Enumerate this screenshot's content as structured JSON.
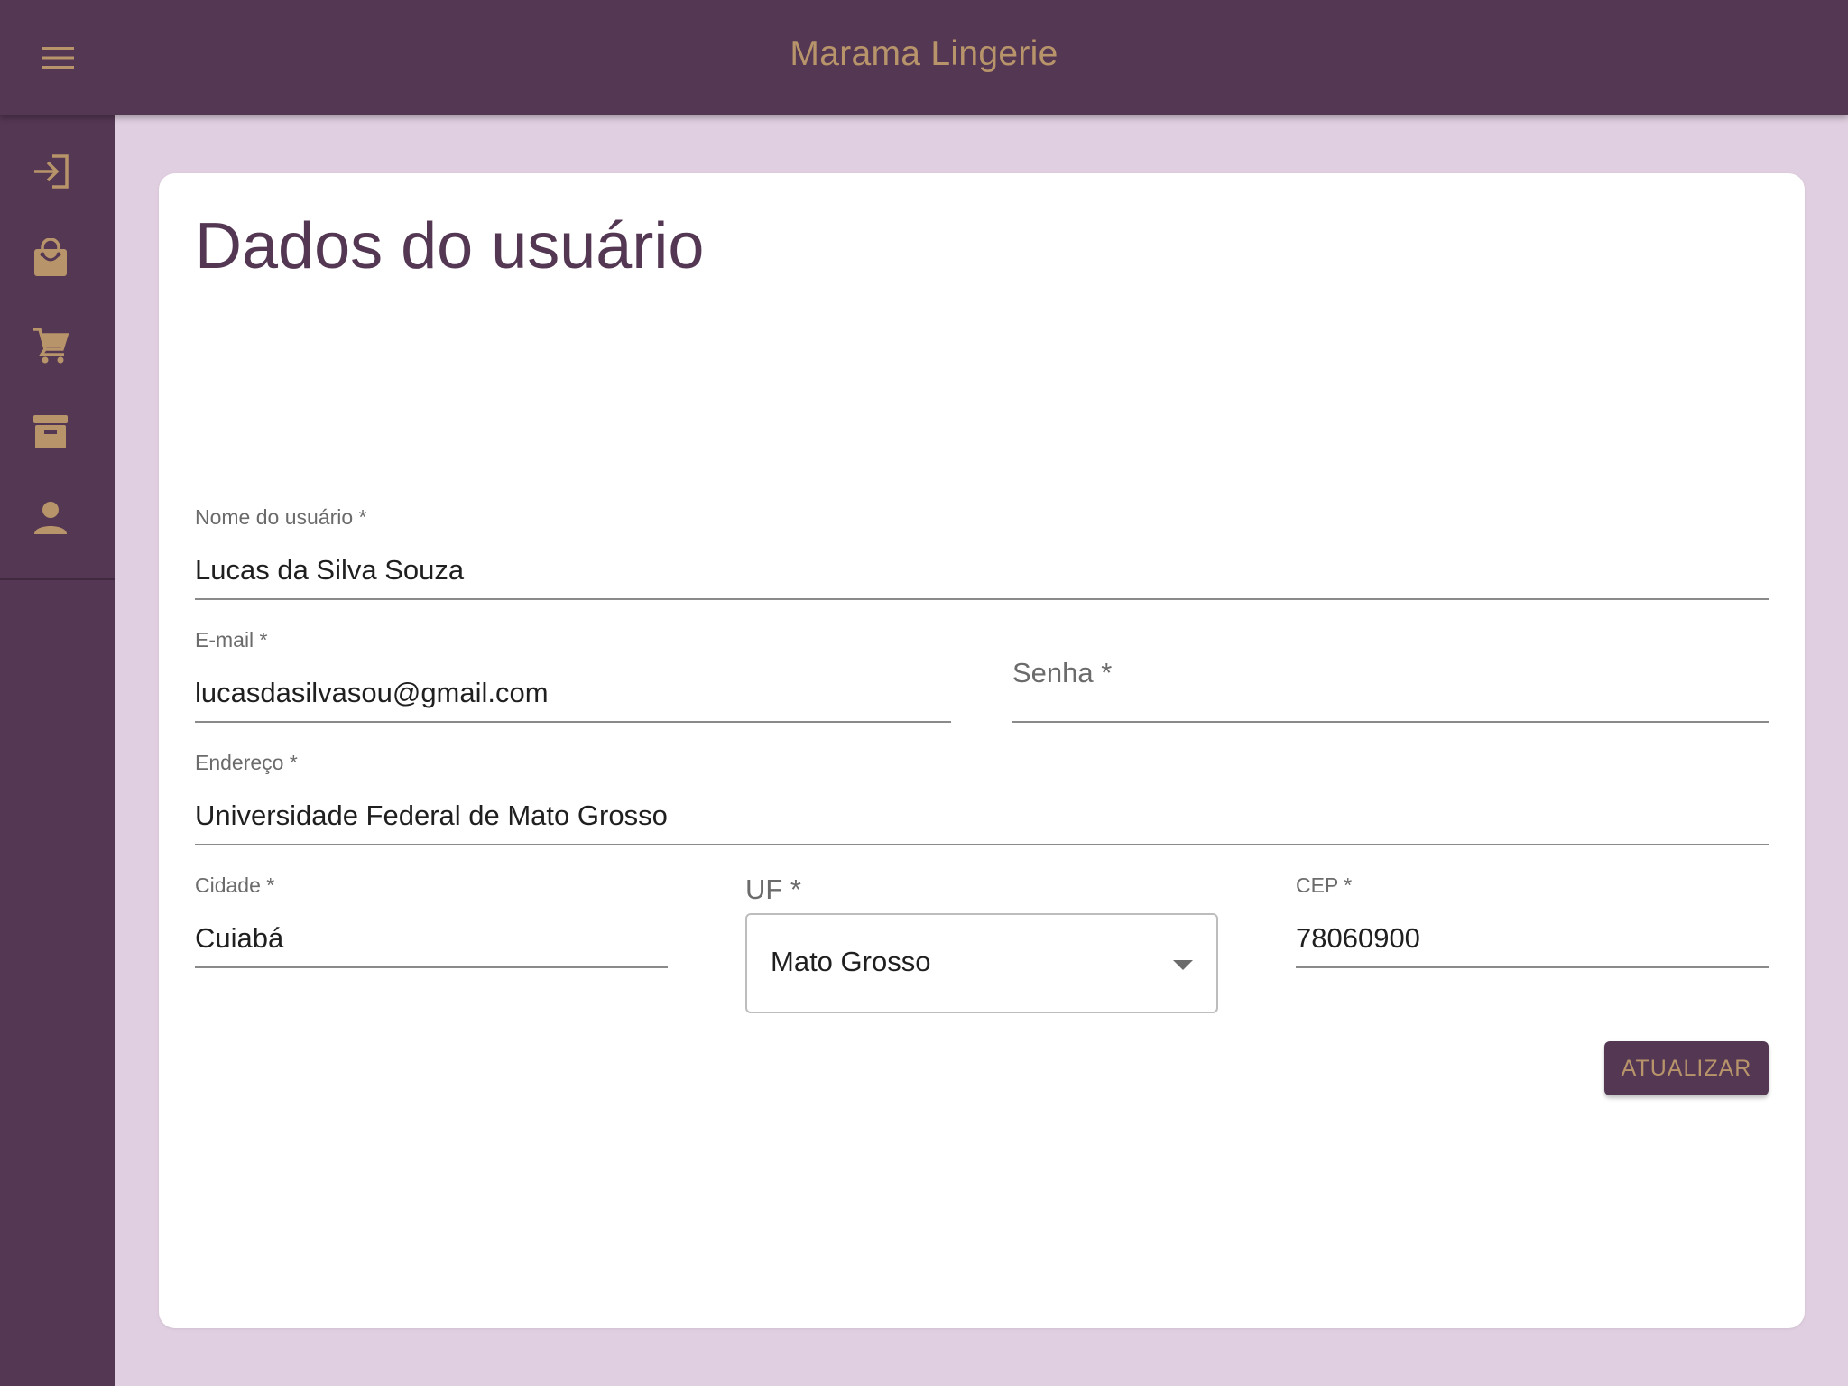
{
  "appbar": {
    "title": "Marama Lingerie",
    "menu_icon": "hamburger-menu-icon"
  },
  "sidebar": {
    "items": [
      {
        "icon": "login-icon"
      },
      {
        "icon": "shopping-bag-icon"
      },
      {
        "icon": "cart-icon"
      },
      {
        "icon": "archive-icon"
      },
      {
        "icon": "person-icon"
      }
    ]
  },
  "page": {
    "title": "Dados do usuário"
  },
  "form": {
    "name": {
      "label": "Nome do usuário *",
      "value": "Lucas da Silva Souza"
    },
    "email": {
      "label": "E-mail *",
      "value": "lucasdasilvasou@gmail.com"
    },
    "password": {
      "label": "Senha *",
      "value": ""
    },
    "address": {
      "label": "Endereço *",
      "value": "Universidade Federal de Mato Grosso"
    },
    "city": {
      "label": "Cidade *",
      "value": "Cuiabá"
    },
    "uf": {
      "label": "UF *",
      "value": "Mato Grosso"
    },
    "cep": {
      "label": "CEP *",
      "value": "78060900"
    },
    "submit_label": "ATUALIZAR"
  },
  "colors": {
    "primary": "#543753",
    "accent": "#b8946a",
    "background": "#e0cfe0",
    "card": "#ffffff"
  }
}
